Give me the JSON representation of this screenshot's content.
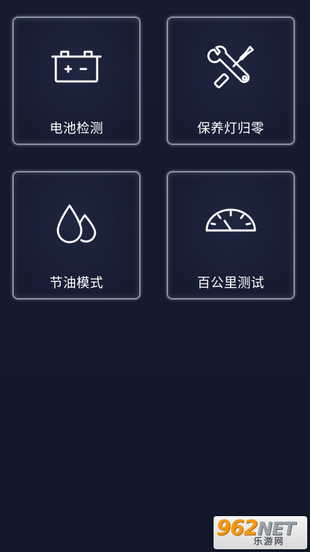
{
  "tiles": [
    {
      "label": "电池检测",
      "icon": "car-battery-icon"
    },
    {
      "label": "保养灯归零",
      "icon": "wrench-screwdriver-icon"
    },
    {
      "label": "节油模式",
      "icon": "oil-drops-icon"
    },
    {
      "label": "百公里测试",
      "icon": "speedometer-gauge-icon"
    }
  ],
  "watermark": {
    "digits": "962",
    "suffix": "NET",
    "caption": "乐游网"
  },
  "colors": {
    "background": "#151a2b",
    "tile_border": "#8b93a6",
    "icon_stroke": "#ffffff",
    "label_text": "#ffffff",
    "watermark_accent": "#f39a11"
  }
}
